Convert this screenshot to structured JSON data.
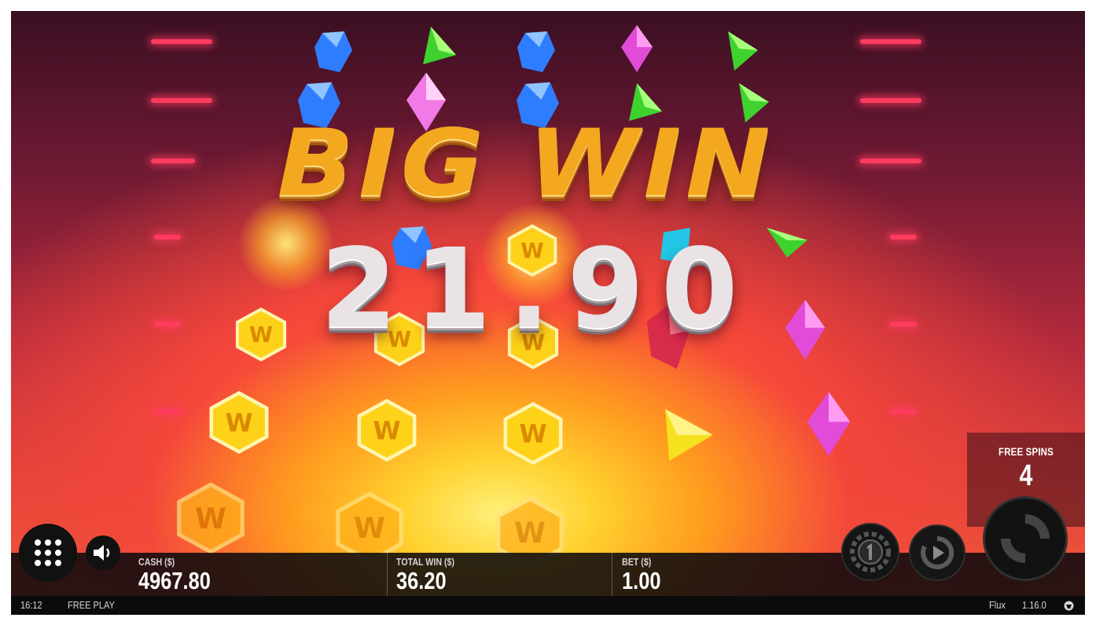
{
  "game": {
    "headline": "BIG WIN",
    "win_amount": "21.90"
  },
  "free_spins": {
    "label": "FREE SPINS",
    "count": "4"
  },
  "stats": {
    "cash_label": "CASH ($)",
    "cash_value": "4967.80",
    "total_win_label": "TOTAL WIN ($)",
    "total_win_value": "36.20",
    "bet_label": "BET ($)",
    "bet_value": "1.00"
  },
  "status": {
    "time": "16:12",
    "mode": "FREE PLAY",
    "game_name": "Flux",
    "version": "1.16.0"
  },
  "symbols": {
    "wild_letter": "W"
  },
  "icons": {
    "menu": "grid-icon",
    "sound": "speaker-icon",
    "coin": "coin-one-icon",
    "autoplay": "autoplay-icon",
    "spin": "spin-icon",
    "logo": "thunderkick-logo-icon"
  },
  "colors": {
    "payline": "#ff3c5e",
    "headline": "#f3a81f",
    "wild": "#ffd21a",
    "gem_blue": "#2f7dff",
    "gem_green": "#3fd22f",
    "gem_pink": "#e24bd8"
  }
}
